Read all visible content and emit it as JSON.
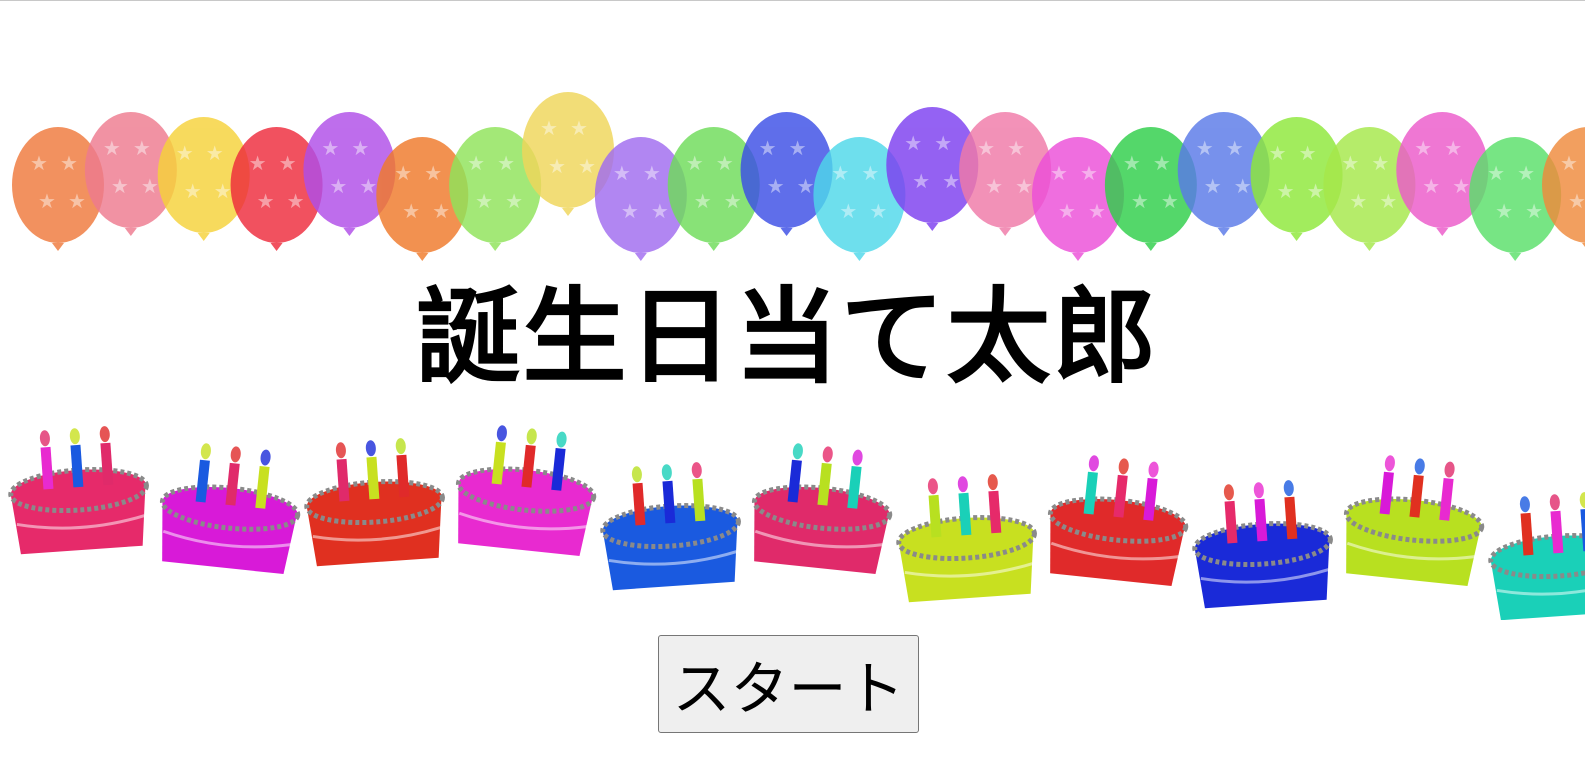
{
  "title": "誕生日当て太郎",
  "start_button_label": "スタート",
  "decorations": {
    "balloons_icon": "balloon-garland",
    "cakes_icon": "birthday-cake-garland"
  },
  "colors": {
    "balloons": [
      "#f07a3c",
      "#ee7b8f",
      "#f6d23a",
      "#ee2b3c",
      "#b04ee8",
      "#f07a2a",
      "#8fe45a",
      "#f0d65a",
      "#a16cf0",
      "#6fdc5a",
      "#3c4fe6",
      "#4fd8ea",
      "#7d3ff0",
      "#f07aa8",
      "#ec4fd8",
      "#2fcf4a",
      "#5a7ae8",
      "#8ee83a",
      "#a6e84a",
      "#ec5aca",
      "#5ae06a",
      "#f08a3c"
    ],
    "cakes": [
      "#e62a6a",
      "#d81ad8",
      "#e03020",
      "#e82ad0",
      "#1a5ae0",
      "#e02a6a",
      "#c8e020",
      "#e02a2a",
      "#1a2ad8",
      "#b8e020",
      "#1ad0b8"
    ]
  }
}
